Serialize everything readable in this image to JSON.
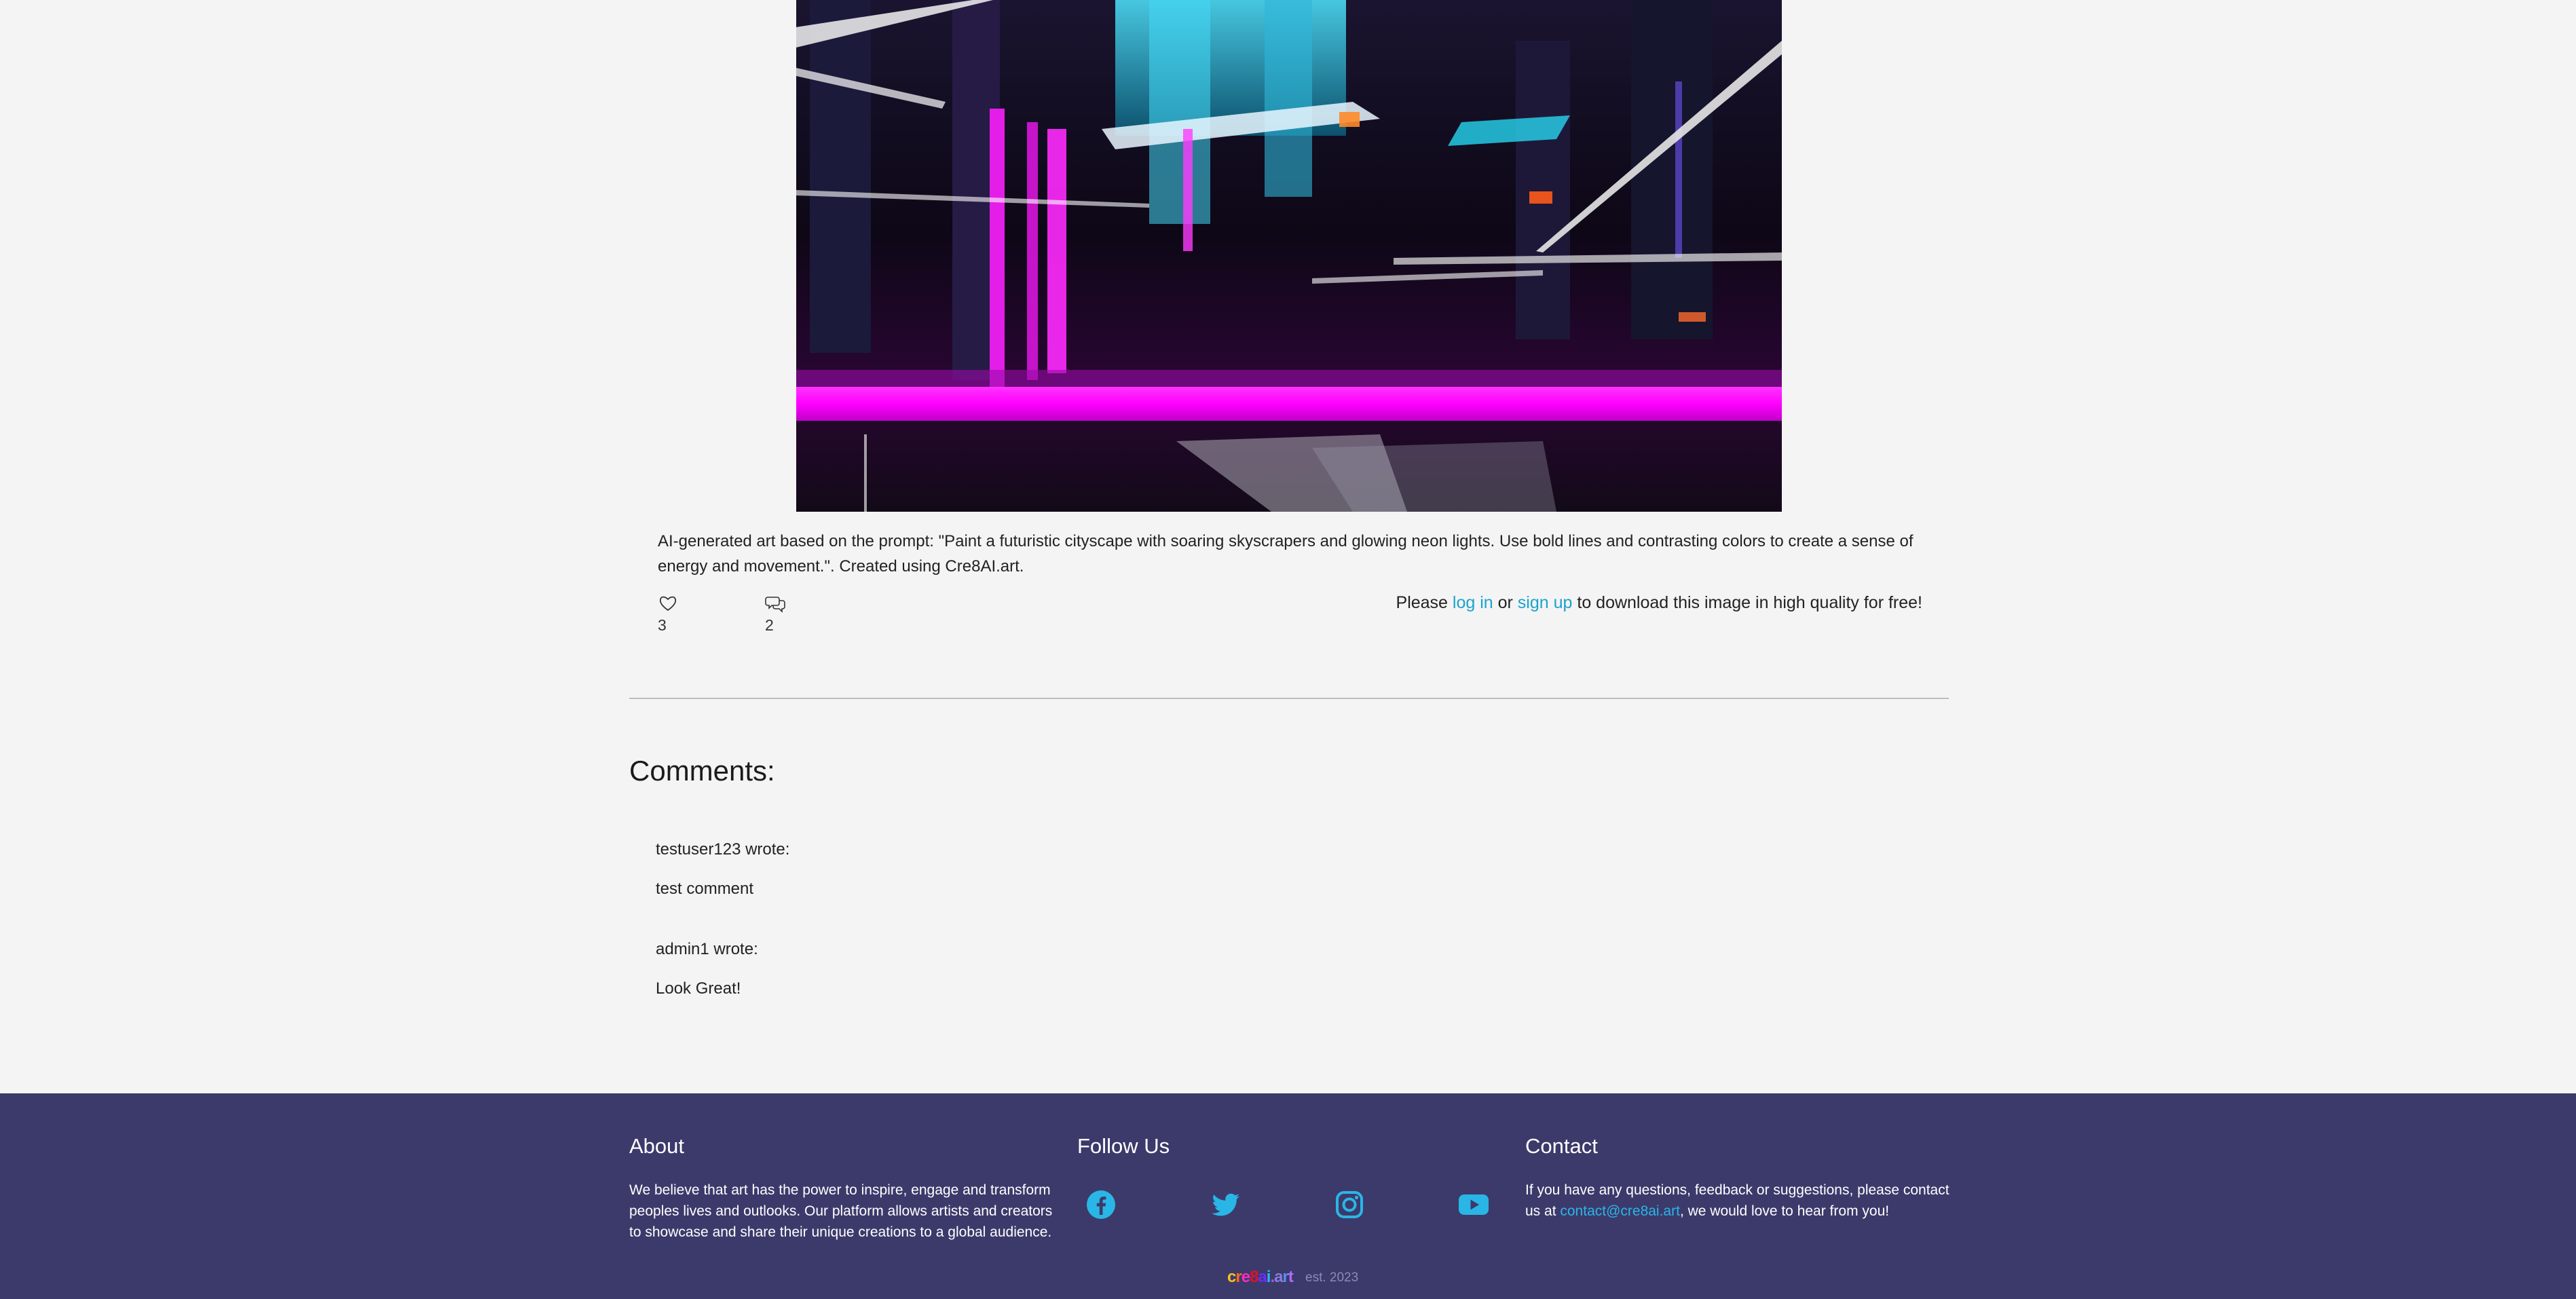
{
  "artwork": {
    "description": "AI-generated art based on the prompt: \"Paint a futuristic cityscape with soaring skyscrapers and glowing neon lights. Use bold lines and contrasting colors to create a sense of energy and movement.\". Created using Cre8AI.art."
  },
  "stats": {
    "likes": "3",
    "comments": "2",
    "like_icon": "heart-icon",
    "comment_icon": "comments-icon"
  },
  "download": {
    "prefix": "Please ",
    "login": "log in",
    "or": " or ",
    "signup": "sign up",
    "suffix": " to download this image in high quality for free!"
  },
  "comments": {
    "heading": "Comments:",
    "items": [
      {
        "author_line": "testuser123 wrote:",
        "body": "test comment"
      },
      {
        "author_line": "admin1 wrote:",
        "body": "Look Great!"
      }
    ]
  },
  "footer": {
    "about": {
      "title": "About",
      "text": "We believe that art has the power to inspire, engage and transform peoples lives and outlooks. Our platform allows artists and creators to showcase and share their unique creations to a global audience."
    },
    "follow": {
      "title": "Follow Us",
      "icons": [
        "facebook-icon",
        "twitter-icon",
        "instagram-icon",
        "youtube-icon"
      ]
    },
    "contact": {
      "title": "Contact",
      "text_before": "If you have any questions, feedback or suggestions, please contact us at ",
      "email": "contact@cre8ai.art",
      "text_after": ", we would love to hear from you!"
    },
    "brand": "cre8ai.art",
    "est": "est. 2023"
  },
  "colors": {
    "link": "#1aa3cc",
    "footer_bg": "#3c3a6b",
    "page_bg": "#f4f4f4"
  }
}
